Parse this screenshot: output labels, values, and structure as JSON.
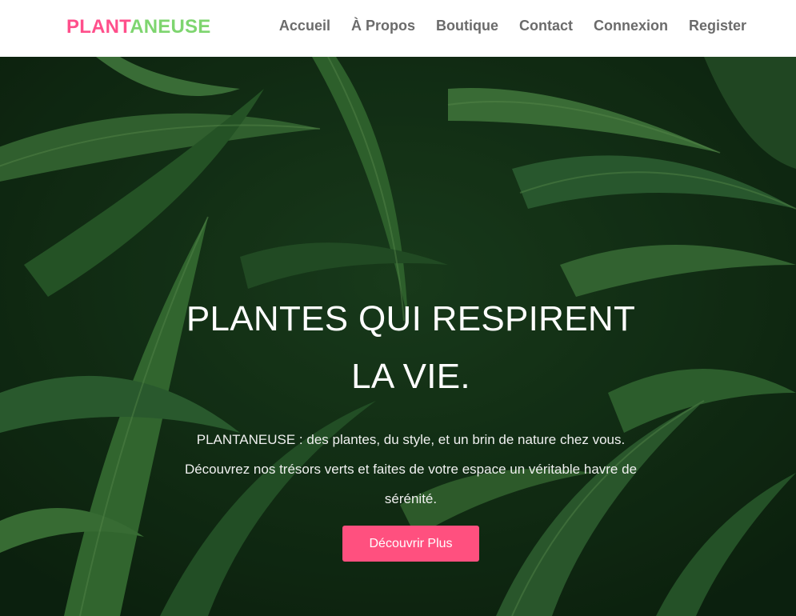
{
  "brand": {
    "part1": "PLANT",
    "part2": "ANEUSE",
    "color1": "#ff4f8b",
    "color2": "#7ed56f"
  },
  "nav": {
    "items": [
      {
        "label": "Accueil"
      },
      {
        "label": "À Propos"
      },
      {
        "label": "Boutique"
      },
      {
        "label": "Contact"
      },
      {
        "label": "Connexion"
      },
      {
        "label": "Register"
      }
    ]
  },
  "hero": {
    "title_line1": "PLANTES QUI RESPIRENT",
    "title_line2": "LA VIE.",
    "desc_line1": "PLANTANEUSE : des plantes, du style, et un brin de nature chez vous.",
    "desc_line2": "Découvrez nos trésors verts et faites de votre espace un véritable havre de",
    "desc_line3": "sérénité.",
    "cta_label": "Découvrir Plus",
    "cta_color": "#ff507f"
  }
}
